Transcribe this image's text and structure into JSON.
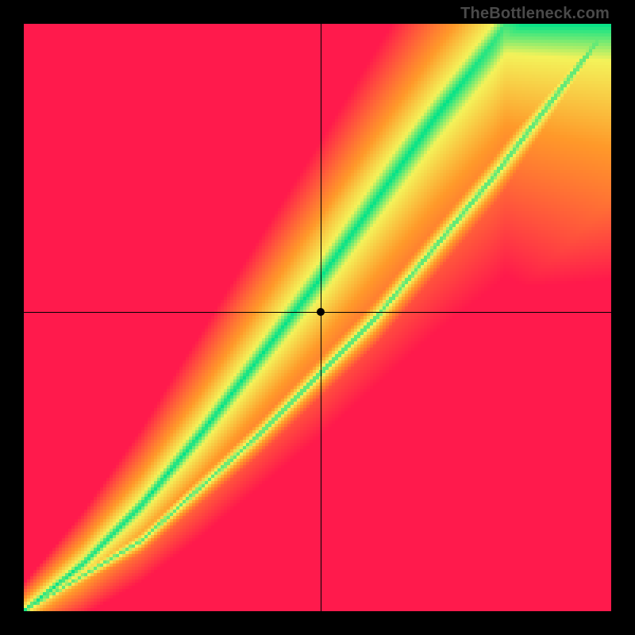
{
  "attribution": "TheBottleneck.com",
  "chart_data": {
    "type": "heatmap",
    "title": "",
    "xlabel": "",
    "ylabel": "",
    "xlim": [
      0,
      1
    ],
    "ylim": [
      0,
      1
    ],
    "grid_resolution": 185,
    "crosshair": {
      "x": 0.505,
      "y": 0.51
    },
    "marker": {
      "x": 0.505,
      "y": 0.51
    },
    "ridge_primary": [
      {
        "x": 0.0,
        "y": 0.0
      },
      {
        "x": 0.1,
        "y": 0.08
      },
      {
        "x": 0.2,
        "y": 0.18
      },
      {
        "x": 0.3,
        "y": 0.3
      },
      {
        "x": 0.4,
        "y": 0.43
      },
      {
        "x": 0.5,
        "y": 0.56
      },
      {
        "x": 0.6,
        "y": 0.7
      },
      {
        "x": 0.7,
        "y": 0.84
      },
      {
        "x": 0.8,
        "y": 0.97
      },
      {
        "x": 0.82,
        "y": 1.0
      }
    ],
    "ridge_secondary": [
      {
        "x": 0.0,
        "y": 0.0
      },
      {
        "x": 0.2,
        "y": 0.12
      },
      {
        "x": 0.4,
        "y": 0.3
      },
      {
        "x": 0.6,
        "y": 0.5
      },
      {
        "x": 0.8,
        "y": 0.74
      },
      {
        "x": 1.0,
        "y": 1.0
      }
    ],
    "colors": {
      "optimal": "#00e38a",
      "near": "#f4f35a",
      "mid": "#ff9a2a",
      "far": "#ff1a4c"
    }
  }
}
